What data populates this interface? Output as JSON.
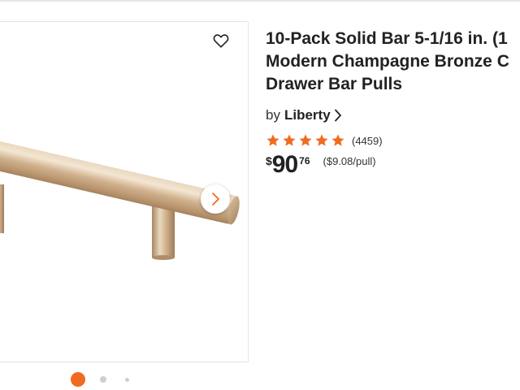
{
  "gallery": {
    "image_alt": "Champagne bronze bar pull",
    "favorite_icon": "heart-outline-icon",
    "next_icon": "chevron-right-icon",
    "dots_count": 3,
    "active_dot": 1,
    "accent_color": "#f06b1f"
  },
  "product": {
    "title_lines": [
      "10-Pack Solid Bar 5-1/16 in. (1",
      "Modern Champagne Bronze C",
      "Drawer Bar Pulls"
    ],
    "brand_prefix": "by",
    "brand_name": "Liberty",
    "rating": {
      "stars": 5,
      "star_color": "#f06b1f",
      "review_count": "(4459)"
    },
    "price": {
      "currency": "$",
      "dollars": "90",
      "cents": "76",
      "unit_price": "($9.08/pull)"
    }
  }
}
